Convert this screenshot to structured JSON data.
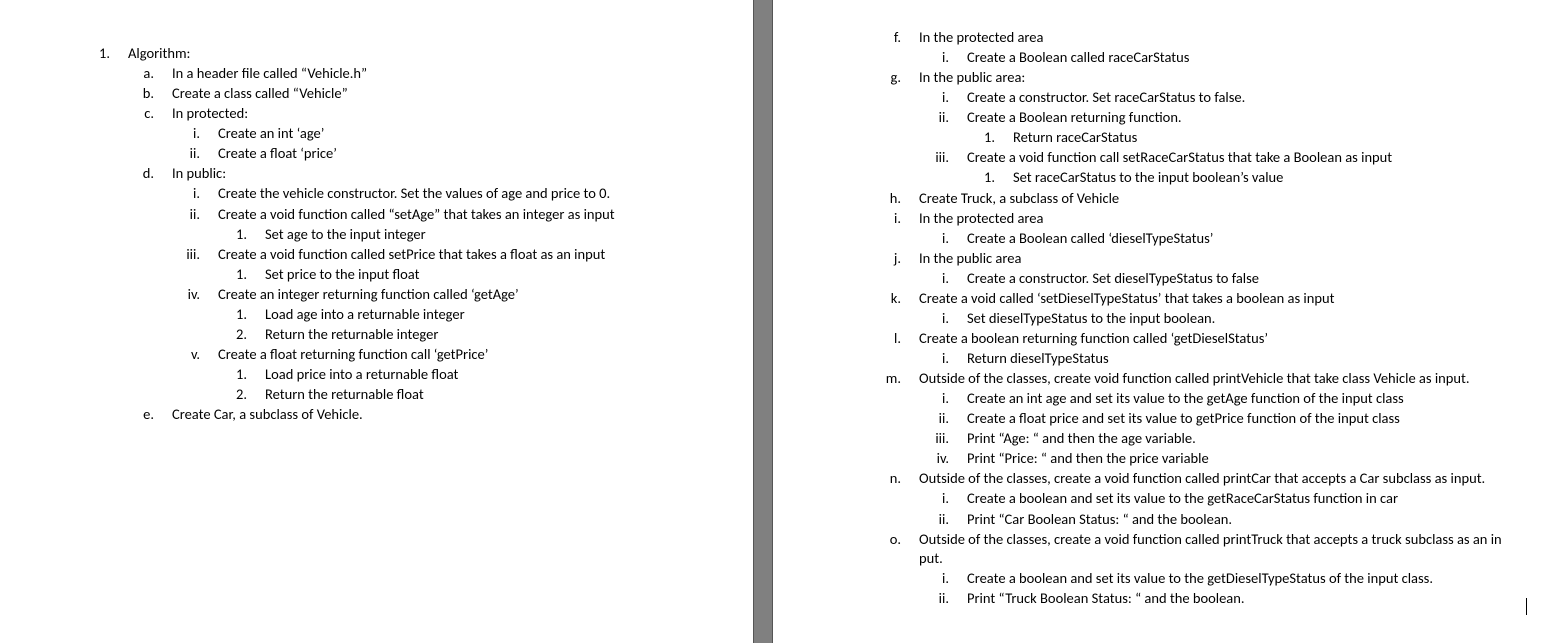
{
  "left": {
    "l1": [
      {
        "m": "1.",
        "t": "Algorithm:"
      }
    ],
    "l2a": [
      {
        "m": "a.",
        "t": "In  a header file called “Vehicle.h”"
      },
      {
        "m": "b.",
        "t": "Create a class called “Vehicle”"
      },
      {
        "m": "c.",
        "t": "In protected:"
      }
    ],
    "l3a": [
      {
        "m": "i.",
        "t": "Create an int ‘age’"
      },
      {
        "m": "ii.",
        "t": "Create a float ‘price’"
      }
    ],
    "l2b": [
      {
        "m": "d.",
        "t": "In public:"
      }
    ],
    "l3b": [
      {
        "m": "i.",
        "t": "Create the vehicle constructor. Set the values of age and price to 0."
      },
      {
        "m": "ii.",
        "t": "Create a void function called “setAge” that takes an integer as input"
      }
    ],
    "l4a": [
      {
        "m": "1.",
        "t": "Set age to the input integer"
      }
    ],
    "l3c": [
      {
        "m": "iii.",
        "t": "Create a void function called setPrice that takes a float as an input"
      }
    ],
    "l4b": [
      {
        "m": "1.",
        "t": "Set price to the input float"
      }
    ],
    "l3d": [
      {
        "m": "iv.",
        "t": "Create an integer returning function called ‘getAge’"
      }
    ],
    "l4c": [
      {
        "m": "1.",
        "t": "Load age into a returnable integer"
      },
      {
        "m": "2.",
        "t": "Return the returnable integer"
      }
    ],
    "l3e": [
      {
        "m": "v.",
        "t": "Create a float returning function call ‘getPrice’"
      }
    ],
    "l4d": [
      {
        "m": "1.",
        "t": "Load price into a returnable float"
      },
      {
        "m": "2.",
        "t": "Return the returnable float"
      }
    ],
    "l2c": [
      {
        "m": "e.",
        "t": "Create Car, a subclass of Vehicle."
      }
    ]
  },
  "right": {
    "l2a": [
      {
        "m": "f.",
        "t": "In the protected area"
      }
    ],
    "l3a": [
      {
        "m": "i.",
        "t": "Create a Boolean called raceCarStatus"
      }
    ],
    "l2b": [
      {
        "m": "g.",
        "t": "In the public area:"
      }
    ],
    "l3b": [
      {
        "m": "i.",
        "t": "Create a constructor. Set raceCarStatus to false."
      },
      {
        "m": "ii.",
        "t": "Create a Boolean returning function."
      }
    ],
    "l4a": [
      {
        "m": "1.",
        "t": "Return raceCarStatus"
      }
    ],
    "l3c": [
      {
        "m": "iii.",
        "t": "Create a void function call setRaceCarStatus that take a Boolean as input"
      }
    ],
    "l4b": [
      {
        "m": "1.",
        "t": "Set raceCarStatus to the input boolean’s value"
      }
    ],
    "l2c": [
      {
        "m": "h.",
        "t": "Create Truck, a subclass of Vehicle"
      },
      {
        "m": "i.",
        "t": "In the protected area"
      }
    ],
    "l3d": [
      {
        "m": "i.",
        "t": "Create a Boolean called ‘dieselTypeStatus’"
      }
    ],
    "l2d": [
      {
        "m": "j.",
        "t": "In the public area"
      }
    ],
    "l3e": [
      {
        "m": "i.",
        "t": "Create a constructor. Set dieselTypeStatus to false"
      }
    ],
    "l2e": [
      {
        "m": "k.",
        "t": "Create a void called ‘setDieselTypeStatus’ that takes a boolean as input"
      }
    ],
    "l3f": [
      {
        "m": "i.",
        "t": "Set dieselTypeStatus to the input boolean."
      }
    ],
    "l2f": [
      {
        "m": "l.",
        "t": "Create a boolean returning function called ‘getDieselStatus’"
      }
    ],
    "l3g": [
      {
        "m": "i.",
        "t": "Return dieselTypeStatus"
      }
    ],
    "l2g": [
      {
        "m": "m.",
        "t": "Outside of the classes, create void function called printVehicle that take class Vehicle as input."
      }
    ],
    "l3h": [
      {
        "m": "i.",
        "t": "Create an int age and set its value to the getAge function of the input class"
      },
      {
        "m": "ii.",
        "t": "Create a float price and set its value to getPrice function of the input class"
      },
      {
        "m": "iii.",
        "t": "Print “Age: “ and then the age variable."
      },
      {
        "m": "iv.",
        "t": "Print “Price: “ and then the price variable"
      }
    ],
    "l2h": [
      {
        "m": "n.",
        "t": "Outside of the classes, create a void function called printCar that accepts a Car subclass as input."
      }
    ],
    "l3i": [
      {
        "m": "i.",
        "t": "Create a boolean and set its value to the getRaceCarStatus function in car"
      },
      {
        "m": "ii.",
        "t": "Print “Car Boolean Status: “ and the boolean."
      }
    ],
    "l2i": [
      {
        "m": "o.",
        "t": "Outside of the classes, create a void function called printTruck that accepts a truck subclass as an in put."
      }
    ],
    "l3j": [
      {
        "m": "i.",
        "t": "Create a boolean and set its value to the getDieselTypeStatus of the input class."
      },
      {
        "m": "ii.",
        "t": "Print “Truck Boolean Status: “ and the boolean."
      }
    ]
  }
}
